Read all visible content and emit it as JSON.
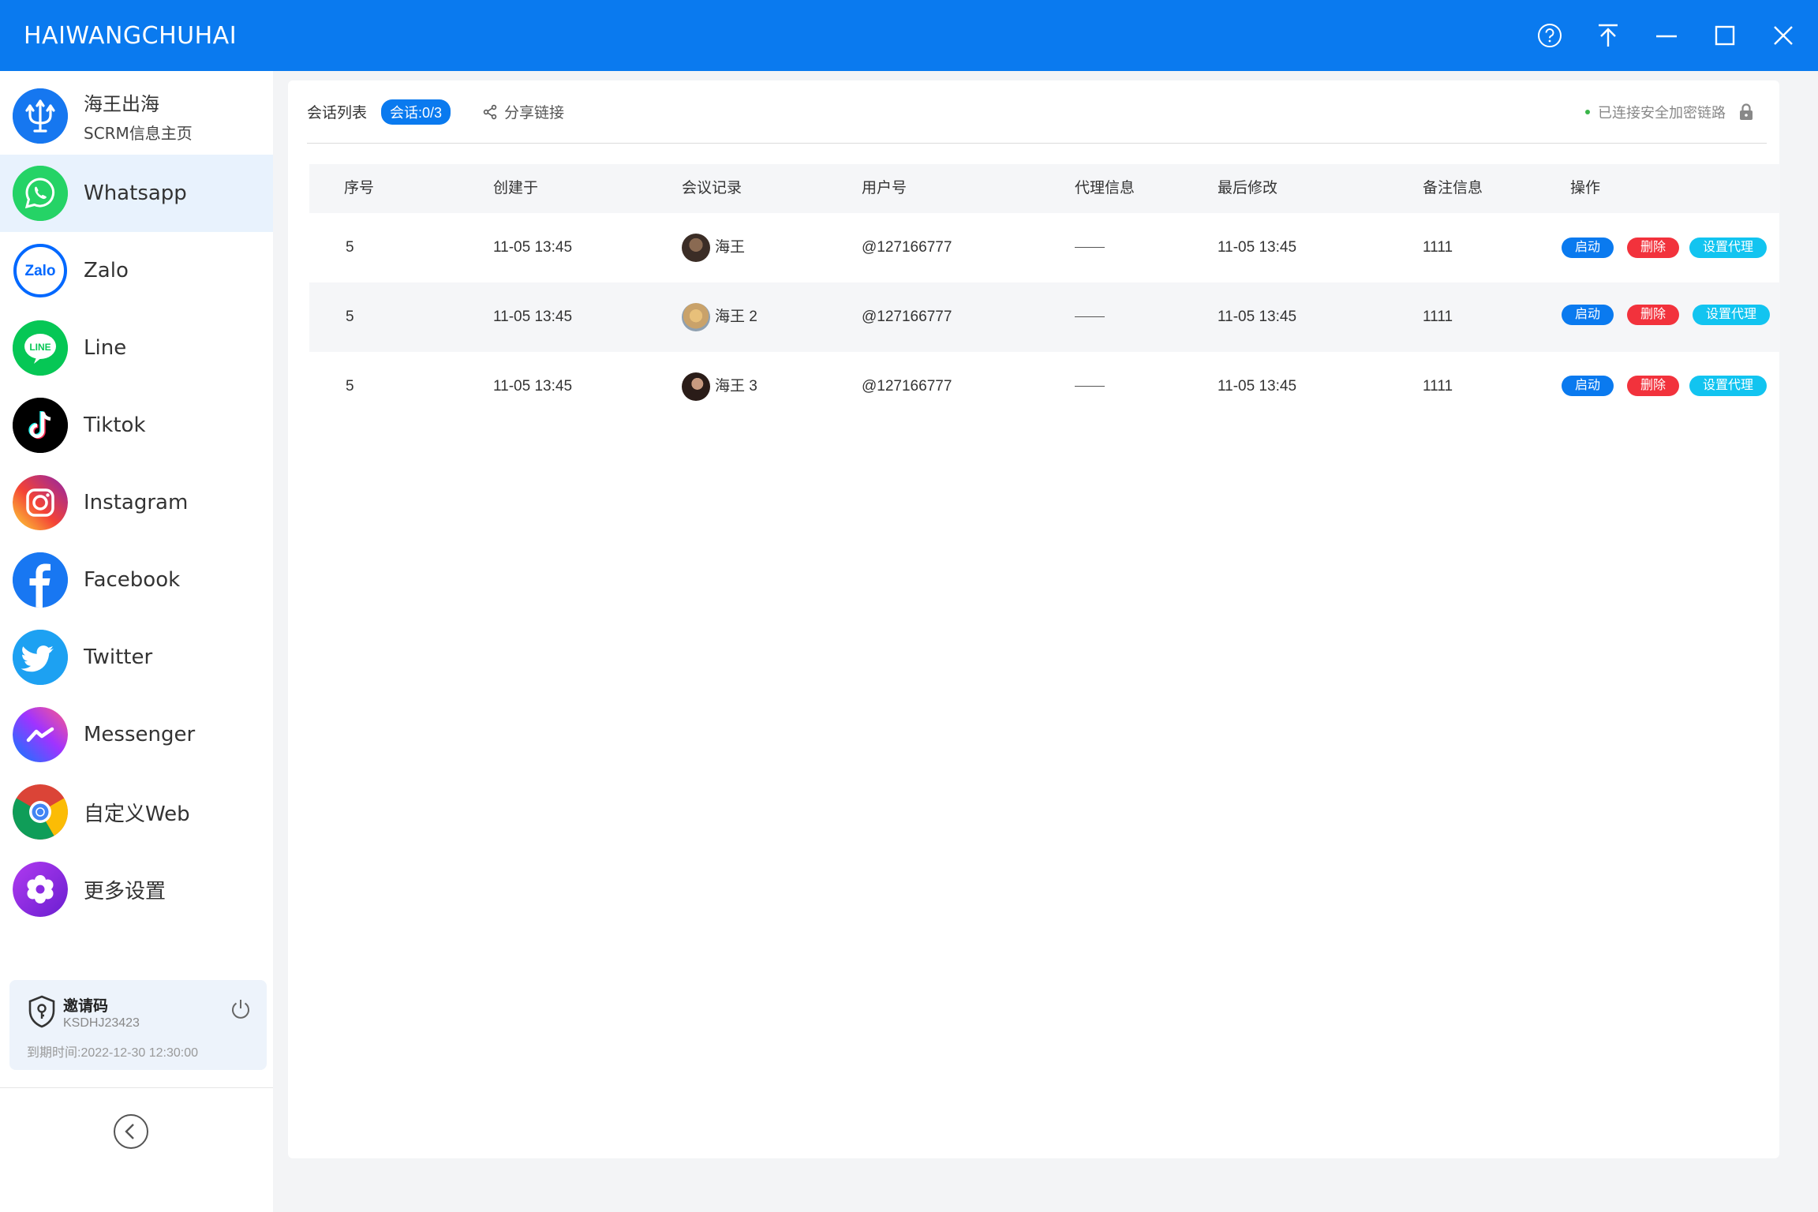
{
  "app": {
    "title": "HAIWANGCHUHAI"
  },
  "window_controls": [
    "help-icon",
    "pin-top-icon",
    "minimize-icon",
    "maximize-icon",
    "close-icon"
  ],
  "sidebar": {
    "brand": {
      "title": "海王出海",
      "subtitle": "SCRM信息主页"
    },
    "items": [
      {
        "label": "Whatsapp",
        "icon": "whatsapp-icon",
        "color": "#25d366"
      },
      {
        "label": "Zalo",
        "icon": "zalo-icon",
        "color": "#0068ff"
      },
      {
        "label": "Line",
        "icon": "line-icon",
        "color": "#06c755"
      },
      {
        "label": "Tiktok",
        "icon": "tiktok-icon",
        "color": "#000000"
      },
      {
        "label": "Instagram",
        "icon": "instagram-icon",
        "color": "#e1306c"
      },
      {
        "label": "Facebook",
        "icon": "facebook-icon",
        "color": "#1877f2"
      },
      {
        "label": "Twitter",
        "icon": "twitter-icon",
        "color": "#1da1f2"
      },
      {
        "label": "Messenger",
        "icon": "messenger-icon",
        "color": "#a033ff"
      },
      {
        "label": "自定义Web",
        "icon": "chrome-icon",
        "color": "#4285f4"
      },
      {
        "label": "更多设置",
        "icon": "gear-icon",
        "color": "#8a2be2"
      }
    ],
    "active_index": 0,
    "invite": {
      "title": "邀请码",
      "code": "KSDHJ23423",
      "expiry": "到期时间:2022-12-30 12:30:00"
    }
  },
  "main": {
    "tab_label": "会话列表",
    "session_count": "会话:0/3",
    "share_label": "分享链接",
    "secure_status": "已连接安全加密链路",
    "columns": [
      "序号",
      "创建于",
      "会议记录",
      "用户号",
      "代理信息",
      "最后修改",
      "备注信息",
      "操作"
    ],
    "rows": [
      {
        "index": "5",
        "created": "11-05 13:45",
        "name": "海王",
        "user": "@127166777",
        "proxy": "",
        "modified": "11-05 13:45",
        "note": "1111"
      },
      {
        "index": "5",
        "created": "11-05 13:45",
        "name": "海王 2",
        "user": "@127166777",
        "proxy": "",
        "modified": "11-05 13:45",
        "note": "1111"
      },
      {
        "index": "5",
        "created": "11-05 13:45",
        "name": "海王 3",
        "user": "@127166777",
        "proxy": "",
        "modified": "11-05 13:45",
        "note": "1111"
      }
    ],
    "actions": {
      "start": "启动",
      "delete": "删除",
      "proxy": "设置代理"
    }
  }
}
